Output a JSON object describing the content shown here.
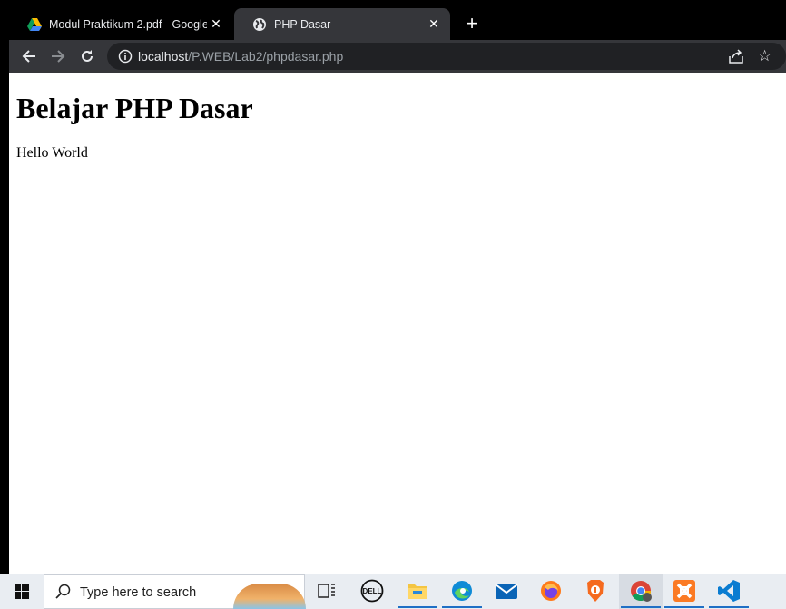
{
  "browser": {
    "tabs": [
      {
        "title": "Modul Praktikum 2.pdf - Google",
        "icon": "google-drive-icon",
        "active": false
      },
      {
        "title": "PHP Dasar",
        "icon": "globe-icon",
        "active": true
      }
    ],
    "address": {
      "host": "localhost",
      "path": "/P.WEB/Lab2/phpdasar.php"
    }
  },
  "page": {
    "heading": "Belajar PHP Dasar",
    "paragraph": "Hello World"
  },
  "taskbar": {
    "search_placeholder": "Type here to search",
    "apps": [
      "task-view",
      "dell",
      "file-explorer",
      "edge",
      "mail",
      "firefox",
      "brave",
      "chrome",
      "xampp",
      "vscode"
    ]
  }
}
